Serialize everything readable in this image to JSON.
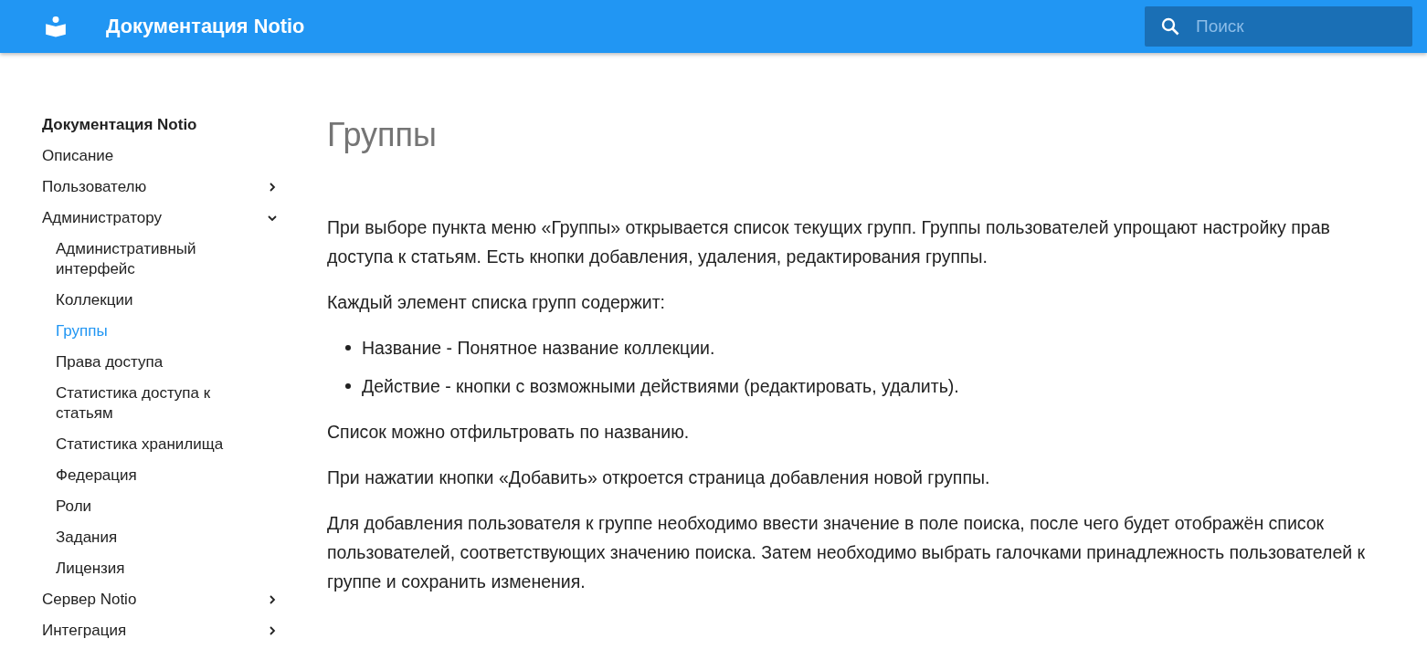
{
  "header": {
    "title": "Документация Notio",
    "search": {
      "placeholder": "Поиск"
    }
  },
  "sidebar": {
    "title": "Документация Notio",
    "items": [
      {
        "label": "Описание",
        "selected": false
      },
      {
        "label": "Пользователю",
        "selected": false,
        "expanded": false
      },
      {
        "label": "Администратору",
        "selected": false,
        "expanded": true,
        "children": [
          {
            "label": "Административный интерфейс",
            "selected": false
          },
          {
            "label": "Коллекции",
            "selected": false
          },
          {
            "label": "Группы",
            "selected": true
          },
          {
            "label": "Права доступа",
            "selected": false
          },
          {
            "label": "Статистика доступа к статьям",
            "selected": false
          },
          {
            "label": "Статистика хранилища",
            "selected": false
          },
          {
            "label": "Федерация",
            "selected": false
          },
          {
            "label": "Роли",
            "selected": false
          },
          {
            "label": "Задания",
            "selected": false
          },
          {
            "label": "Лицензия",
            "selected": false
          }
        ]
      },
      {
        "label": "Сервер Notio",
        "selected": false,
        "expanded": false
      },
      {
        "label": "Интеграция",
        "selected": false,
        "expanded": false
      }
    ]
  },
  "content": {
    "title": "Группы",
    "blocks": [
      {
        "kind": "paragraph",
        "text": "При выборе пункта меню «Группы» открывается список текущих групп. Группы пользователей упрощают настройку прав доступа к статьям. Есть кнопки добавления, удаления, редактирования группы."
      },
      {
        "kind": "paragraph",
        "text": "Каждый элемент списка групп содержит:"
      },
      {
        "kind": "list",
        "items": [
          "Название - Понятное название коллекции.",
          "Действие - кнопки с возможными действиями (редактировать, удалить)."
        ]
      },
      {
        "kind": "paragraph",
        "text": "Список можно отфильтровать по названию."
      },
      {
        "kind": "paragraph",
        "text": "При нажатии кнопки «Добавить» откроется страница добавления новой группы."
      },
      {
        "kind": "paragraph",
        "text": "Для добавления пользователя к группе необходимо ввести значение в поле поиска, после чего будет отображён список пользователей, соответствующих значению поиска. Затем необходимо выбрать галочками принадлежность пользователей к группе и сохранить изменения."
      }
    ]
  }
}
